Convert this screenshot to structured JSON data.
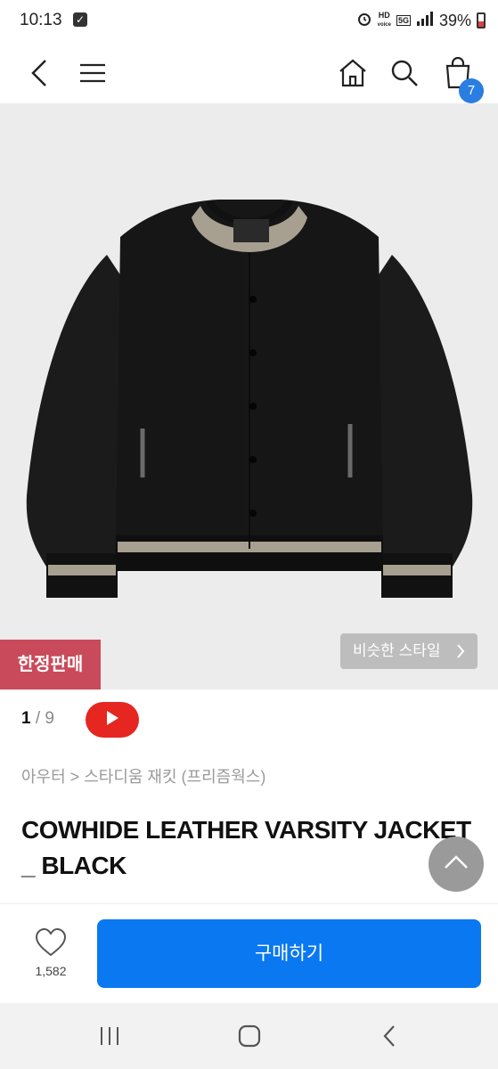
{
  "status_bar": {
    "time": "10:13",
    "hd_label": "HD",
    "voice_label": "voice",
    "network": "5G",
    "battery": "39%"
  },
  "nav": {
    "cart_count": "7",
    "icons": [
      "back-icon",
      "menu-icon",
      "home-icon",
      "search-icon",
      "cart-icon"
    ]
  },
  "product": {
    "limited_badge": "한정판매",
    "similar_style": "비슷한 스타일",
    "page_current": "1",
    "page_sep": " / ",
    "page_total": "9",
    "breadcrumb": "아우터 > 스타디움 재킷 (프리즘웍스)",
    "title": "COWHIDE LEATHER VARSITY JACKET _ BLACK"
  },
  "bottom": {
    "like_count": "1,582",
    "buy_label": "구매하기"
  },
  "colors": {
    "accent": "#0a78f0",
    "badge": "#c94a5a",
    "cart_badge": "#2a7de1",
    "youtube": "#e52621"
  }
}
